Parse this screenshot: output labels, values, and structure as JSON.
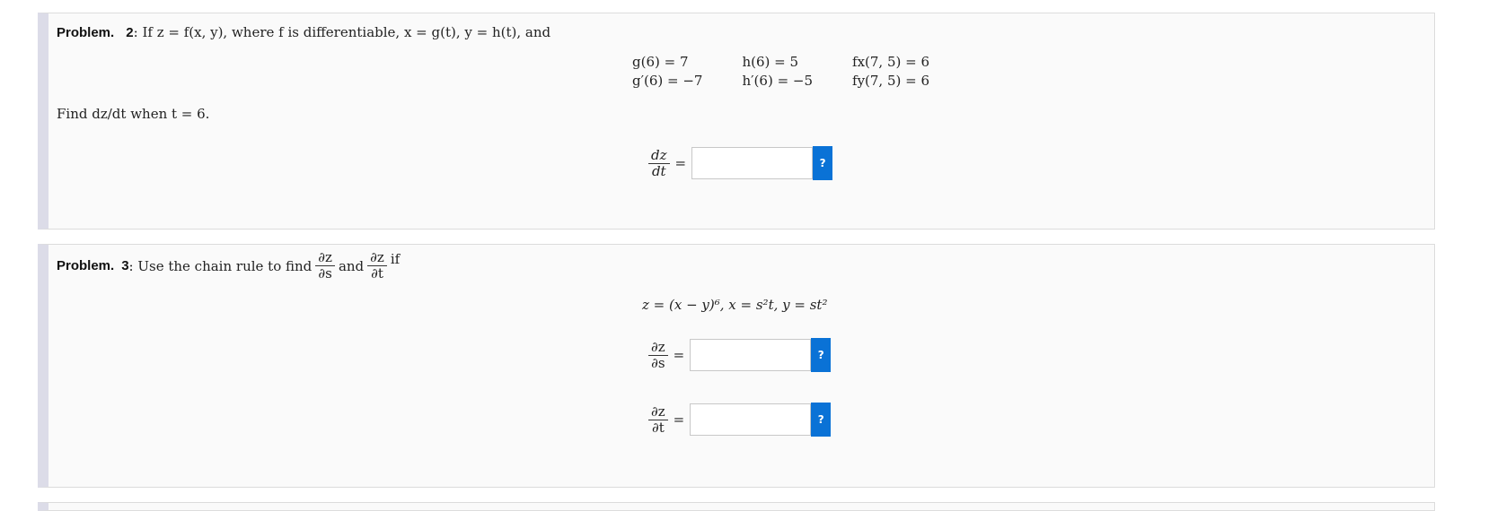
{
  "problem2": {
    "label": "Problem.",
    "number": "2",
    "statement_prefix": ": If z = f(x, y), where f is differentiable, x = g(t), y = h(t), and",
    "table": [
      [
        "g(6) = 7",
        "h(6) = 5",
        "fx(7, 5) = 6"
      ],
      [
        "g′(6) = −7",
        "h′(6) = −5",
        "fy(7, 5) = 6"
      ]
    ],
    "find_text": "Find dz/dt when t = 6.",
    "answer_label_num": "dz",
    "answer_label_den": "dt",
    "equals": "=",
    "answer_value": "",
    "help_label": "?"
  },
  "problem3": {
    "label": "Problem.",
    "number": "3",
    "intro": ": Use the chain rule to find",
    "and": "and",
    "if": "if",
    "dzds_num": "∂z",
    "dzds_den": "∂s",
    "dzdt_num": "∂z",
    "dzdt_den": "∂t",
    "equation": "z = (x − y)⁶,  x = s²t,  y = st²",
    "equals": "=",
    "answer_s_value": "",
    "answer_t_value": "",
    "help_label": "?"
  }
}
